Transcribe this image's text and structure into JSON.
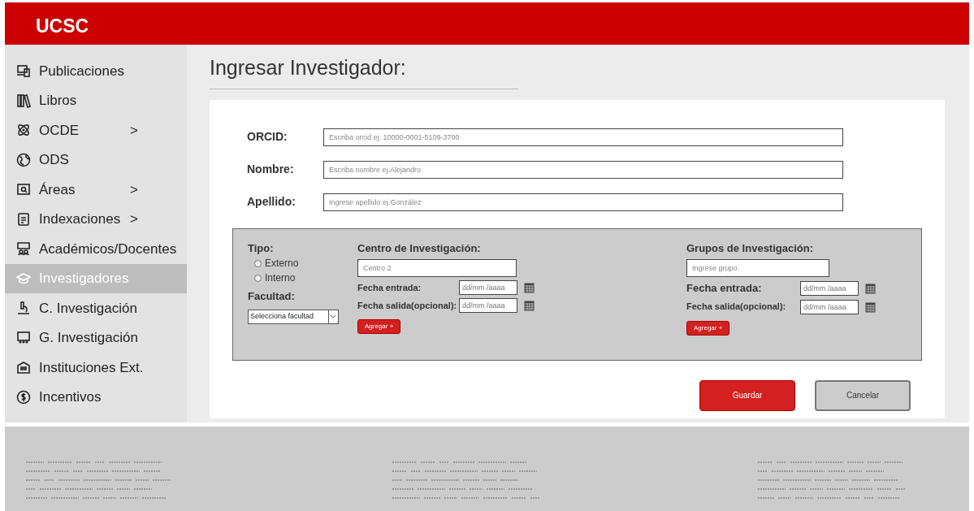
{
  "header": {
    "title": "UCSC"
  },
  "sidebar": {
    "items": [
      {
        "label": "Publicaciones",
        "selected": false
      },
      {
        "label": "Libros",
        "selected": false
      },
      {
        "label": "OCDE",
        "chevron": ">",
        "selected": false
      },
      {
        "label": "ODS",
        "selected": false
      },
      {
        "label": "Áreas",
        "chevron": ">",
        "selected": false
      },
      {
        "label": "Indexaciones",
        "chevron": ">",
        "selected": false
      },
      {
        "label": "Académicos/Docentes",
        "selected": false
      },
      {
        "label": "Investigadores",
        "selected": true
      },
      {
        "label": "C. Investigación",
        "selected": false
      },
      {
        "label": "G. Investigación",
        "selected": false
      },
      {
        "label": "Instituciones Ext.",
        "selected": false
      },
      {
        "label": "Incentivos",
        "selected": false
      }
    ]
  },
  "page_title": "Ingresar Investigador:",
  "fields": [
    {
      "label": "ORCID:",
      "placeholder": "Escriba orcid ej. 10000-0001-5109-3700"
    },
    {
      "label": "Nombre:",
      "placeholder": "Escriba nombre ej.Alejandro"
    },
    {
      "label": "Apellido:",
      "placeholder": "Ingrese apellido ej.González"
    }
  ],
  "panel": {
    "tipo": {
      "label": "Tipo:",
      "options": [
        {
          "label": "Externo",
          "selected": false
        },
        {
          "label": "Interno",
          "selected": false
        }
      ]
    },
    "facultad": {
      "label": "Facultad:",
      "value": "Selecciona facultad"
    },
    "centro": {
      "heading": "Centro de Investigación:",
      "placeholder": "Centro 2",
      "entrada_label": "Fecha entrada:",
      "entrada_placeholder": "dd/mm /aaaa",
      "salida_label": "Fecha salida(opcional):",
      "salida_placeholder": "dd/mm /aaaa",
      "button": "Agregar +"
    },
    "grupos": {
      "heading": "Grupos de Investigación:",
      "placeholder": "Ingrese grupo.",
      "entrada_label": "Fecha entrada:",
      "entrada_placeholder": "dd/mm /aaaa",
      "salida_label": "Fecha salida(opcional):",
      "salida_placeholder": "dd/mm /aaaa",
      "button": "Agregar +"
    }
  },
  "actions": [
    {
      "label": "Guardar",
      "kind": "primary"
    },
    {
      "label": "Cancelar",
      "kind": "secondary"
    }
  ]
}
